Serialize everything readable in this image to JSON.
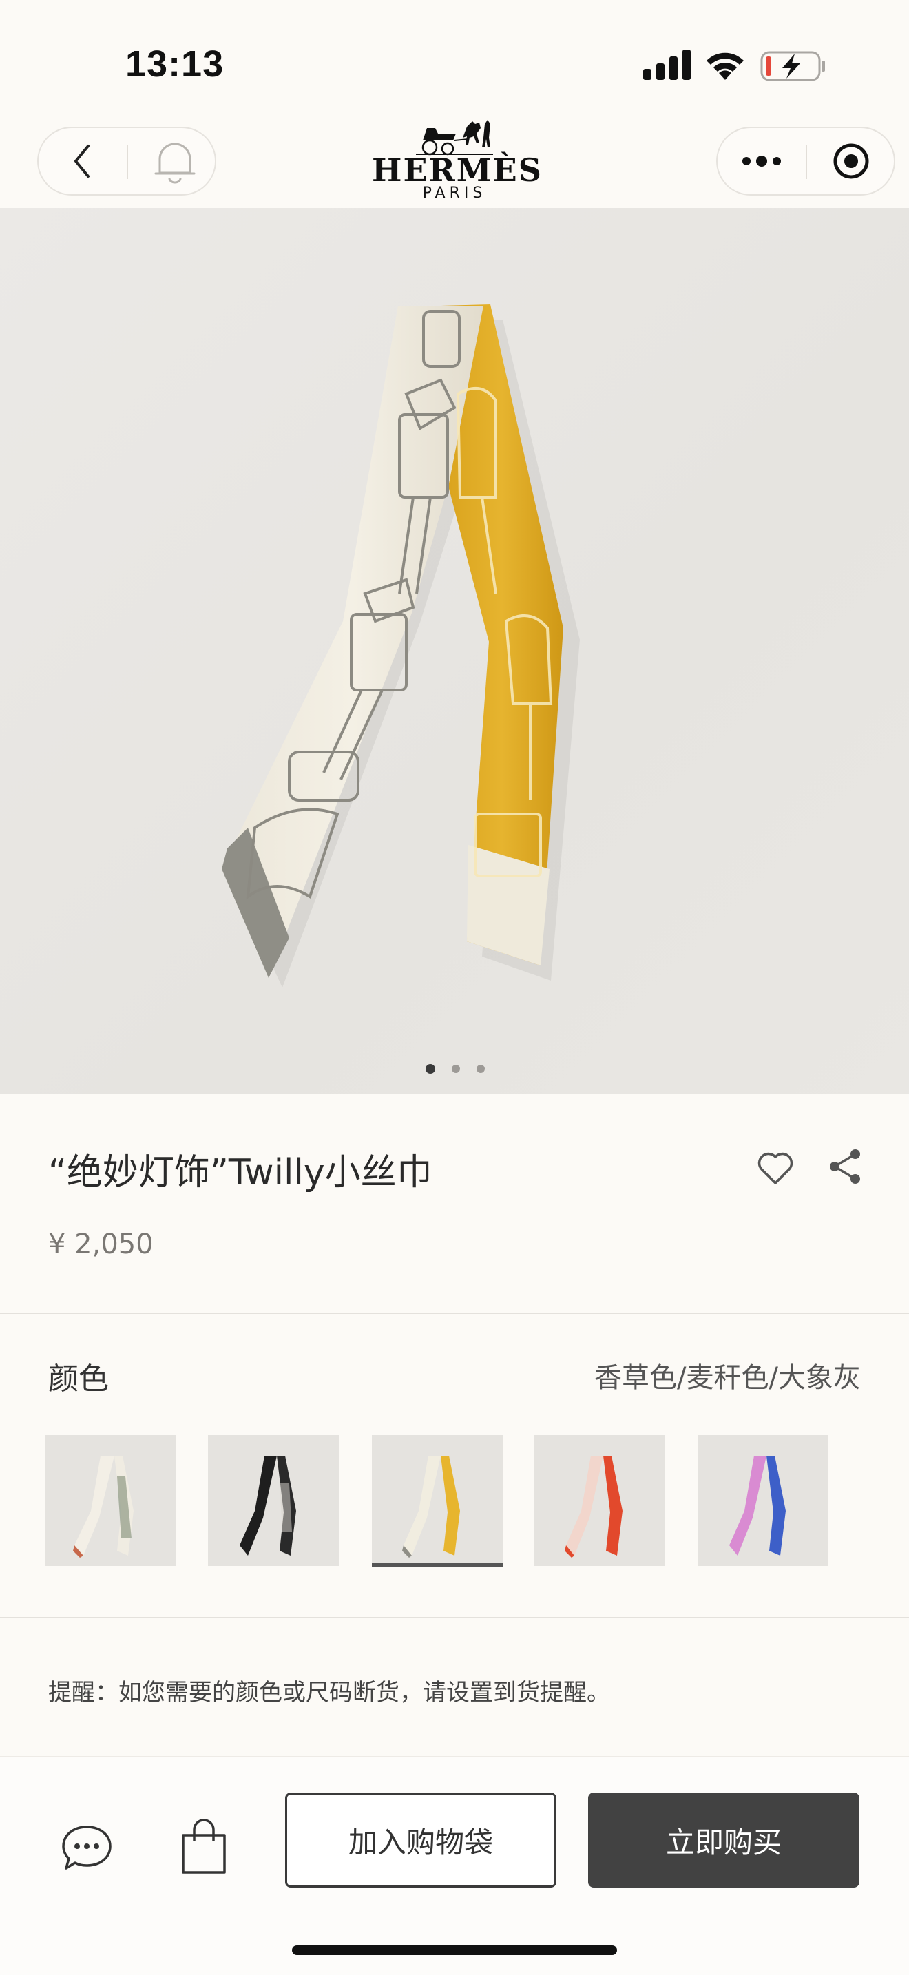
{
  "status_bar": {
    "time": "13:13"
  },
  "nav": {
    "brand_name": "HERMÈS",
    "brand_city": "PARIS",
    "icons": {
      "back": "chevron-left-icon",
      "bell": "bell-icon",
      "more": "more-dots-icon",
      "close": "target-icon"
    }
  },
  "gallery": {
    "total_images": 3,
    "active_index": 0
  },
  "product": {
    "title": "“绝妙灯饰”Twilly小丝巾",
    "price": "¥ 2,050"
  },
  "color": {
    "label": "颜色",
    "selected_value": "香草色/麦秆色/大象灰",
    "swatch_count": 5,
    "selected_index": 2,
    "swatch_colors": [
      [
        "#f3efe6",
        "#8f9a84"
      ],
      [
        "#1e1e1e",
        "#d9d6d0"
      ],
      [
        "#f1ede0",
        "#e7b52e"
      ],
      [
        "#f2d6cc",
        "#e2492c"
      ],
      [
        "#d98bd2",
        "#3d5fc8"
      ]
    ]
  },
  "reminder": "提醒：如您需要的颜色或尺码断货，请设置到货提醒。",
  "bottom": {
    "add_to_bag": "加入购物袋",
    "buy_now": "立即购买",
    "icons": {
      "chat": "chat-bubble-icon",
      "bag": "shopping-bag-icon"
    }
  },
  "colors": {
    "primary_button": "#424242",
    "background": "#fcfaf6"
  }
}
